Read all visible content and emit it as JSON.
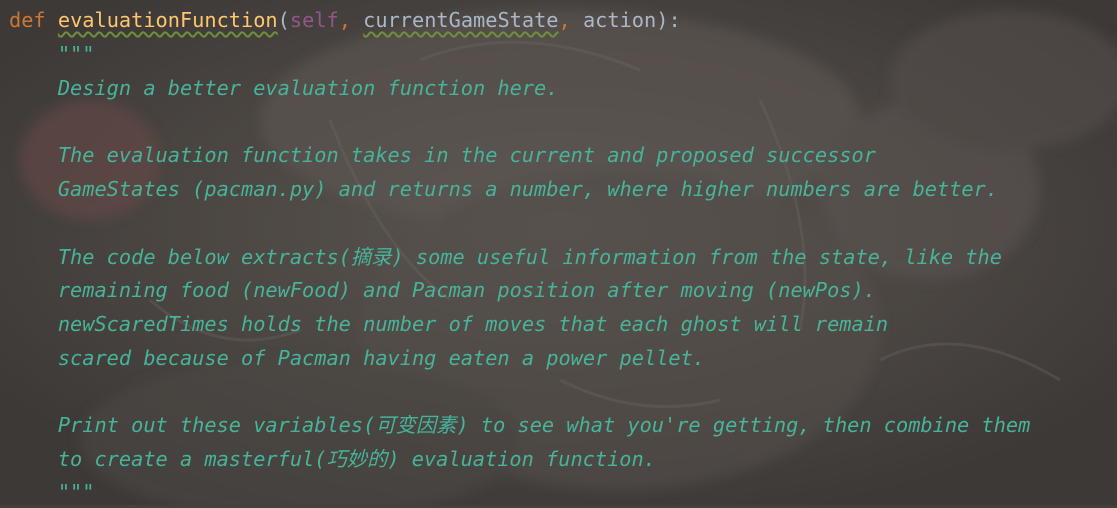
{
  "code": {
    "line1": {
      "keyword": "def",
      "function_name": "evaluationFunction",
      "open_paren": "(",
      "self": "self",
      "comma1": ",",
      "param1": "currentGameState",
      "comma2": ",",
      "param2": "action",
      "close": "):"
    },
    "docstring_open": "\"\"\"",
    "docstring_lines": [
      "Design a better evaluation function here.",
      "",
      "The evaluation function takes in the current and proposed successor",
      "GameStates (pacman.py) and returns a number, where higher numbers are better.",
      "",
      "The code below extracts(摘录) some useful information from the state, like the",
      "remaining food (newFood) and Pacman position after moving (newPos).",
      "newScaredTimes holds the number of moves that each ghost will remain",
      "scared because of Pacman having eaten a power pellet.",
      "",
      "Print out these variables(可变因素) to see what you're getting, then combine them",
      "to create a masterful(巧妙的) evaluation function."
    ],
    "docstring_close": "\"\"\""
  },
  "colors": {
    "keyword": "#cc7832",
    "function_name": "#ffc66d",
    "parameter": "#a9b7c6",
    "self": "#94558d",
    "docstring": "#47b39a",
    "background": "#44403d"
  }
}
